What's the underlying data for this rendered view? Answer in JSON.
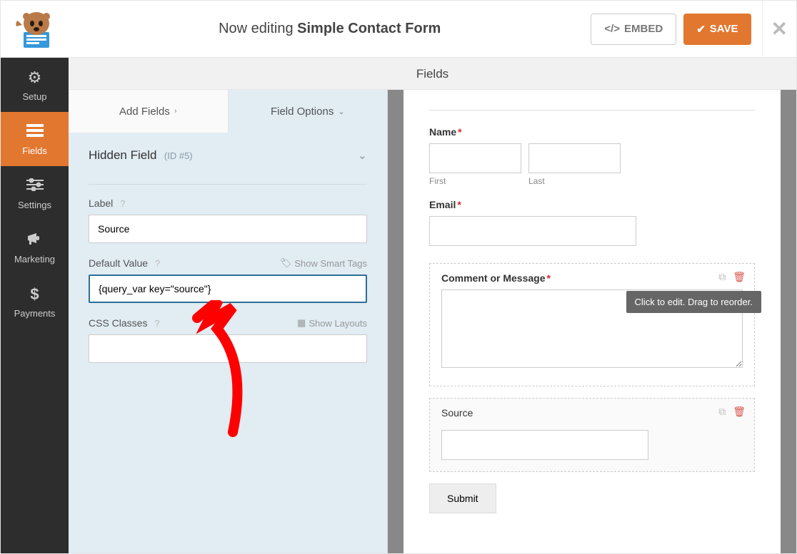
{
  "header": {
    "editing_prefix": "Now editing ",
    "form_name": "Simple Contact Form",
    "embed_label": "EMBED",
    "save_label": "SAVE"
  },
  "sidebar": {
    "items": [
      {
        "label": "Setup",
        "icon": "gear"
      },
      {
        "label": "Fields",
        "icon": "list"
      },
      {
        "label": "Settings",
        "icon": "sliders"
      },
      {
        "label": "Marketing",
        "icon": "bullhorn"
      },
      {
        "label": "Payments",
        "icon": "dollar"
      }
    ]
  },
  "section_title": "Fields",
  "tabs": {
    "add": "Add Fields",
    "options": "Field Options"
  },
  "options": {
    "field_title": "Hidden Field",
    "field_id": "(ID #5)",
    "label_label": "Label",
    "label_value": "Source",
    "default_label": "Default Value",
    "default_value": "{query_var key=\"source\"}",
    "show_smart_tags": "Show Smart Tags",
    "css_label": "CSS Classes",
    "css_value": "",
    "show_layouts": "Show Layouts"
  },
  "preview": {
    "name_label": "Name",
    "first_label": "First",
    "last_label": "Last",
    "email_label": "Email",
    "comment_label": "Comment or Message",
    "tooltip": "Click to edit. Drag to reorder.",
    "source_label": "Source",
    "submit_label": "Submit"
  }
}
